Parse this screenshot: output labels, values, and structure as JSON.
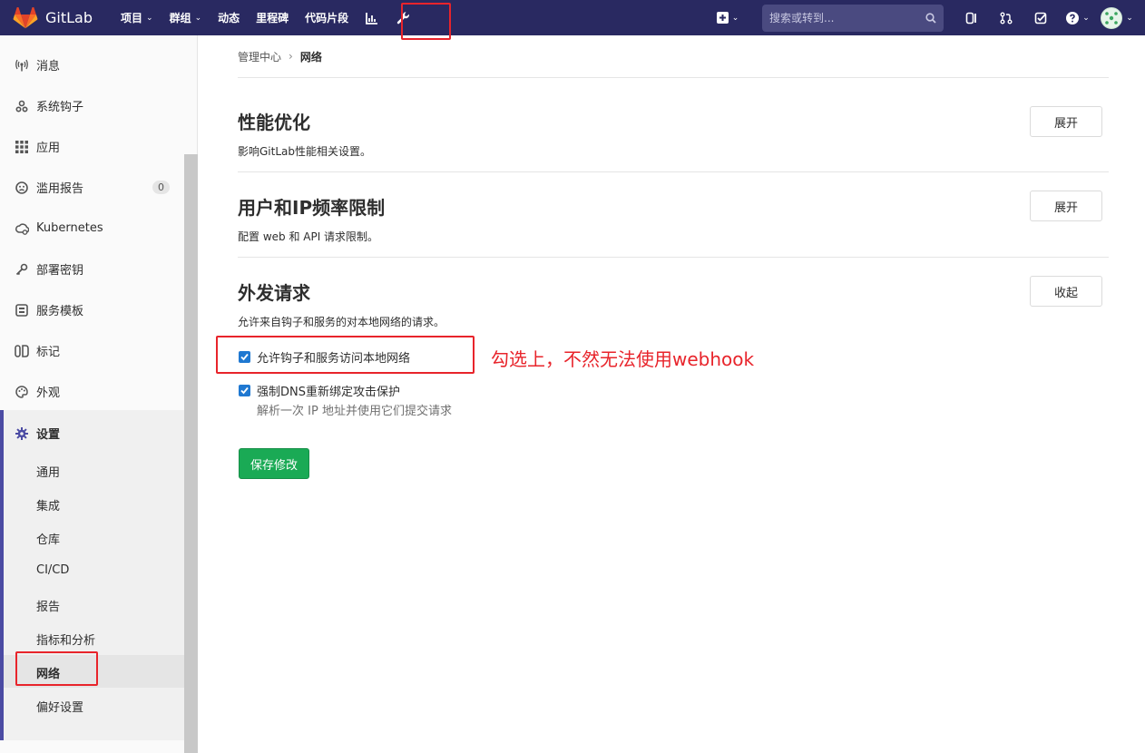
{
  "topbar": {
    "brand": "GitLab",
    "nav": [
      {
        "label": "项目",
        "caret": true
      },
      {
        "label": "群组",
        "caret": true
      },
      {
        "label": "动态",
        "caret": false
      },
      {
        "label": "里程碑",
        "caret": false
      },
      {
        "label": "代码片段",
        "caret": false
      }
    ],
    "search_placeholder": "搜索或转到...",
    "caret_glyph": "⌄"
  },
  "sidebar": {
    "items": [
      {
        "label": "消息",
        "icon": "broadcast-icon"
      },
      {
        "label": "系统钩子",
        "icon": "hook-icon"
      },
      {
        "label": "应用",
        "icon": "applications-icon"
      },
      {
        "label": "滥用报告",
        "icon": "abuse-icon",
        "badge": "0"
      },
      {
        "label": "Kubernetes",
        "icon": "kubernetes-icon"
      },
      {
        "label": "部署密钥",
        "icon": "key-icon"
      },
      {
        "label": "服务模板",
        "icon": "template-icon"
      },
      {
        "label": "标记",
        "icon": "labels-icon"
      },
      {
        "label": "外观",
        "icon": "palette-icon"
      }
    ],
    "settings": {
      "label": "设置",
      "icon": "gear-icon",
      "children": [
        "通用",
        "集成",
        "仓库",
        "CI/CD",
        "报告",
        "指标和分析",
        "网络",
        "偏好设置"
      ],
      "active_child": "网络"
    }
  },
  "breadcrumb": {
    "parent": "管理中心",
    "separator": "›",
    "current": "网络"
  },
  "sections": [
    {
      "title": "性能优化",
      "description": "影响GitLab性能相关设置。",
      "button": "展开"
    },
    {
      "title": "用户和IP频率限制",
      "description": "配置 web 和 API 请求限制。",
      "button": "展开"
    },
    {
      "title": "外发请求",
      "description": "允许来自钩子和服务的对本地网络的请求。",
      "button": "收起"
    }
  ],
  "outbound": {
    "allow_local_label": "允许钩子和服务访问本地网络",
    "allow_local_checked": true,
    "dns_rebind_label": "强制DNS重新绑定攻击保护",
    "dns_rebind_checked": true,
    "dns_rebind_help": "解析一次 IP 地址并使用它们提交请求",
    "save_label": "保存修改"
  },
  "annotation": {
    "note": "勾选上，不然无法使用webhook",
    "color": "#e8242b"
  },
  "colors": {
    "topbar": "#292961",
    "primary": "#1f78d1",
    "success": "#1aaa55",
    "settings_accent": "#4b4ba3"
  }
}
